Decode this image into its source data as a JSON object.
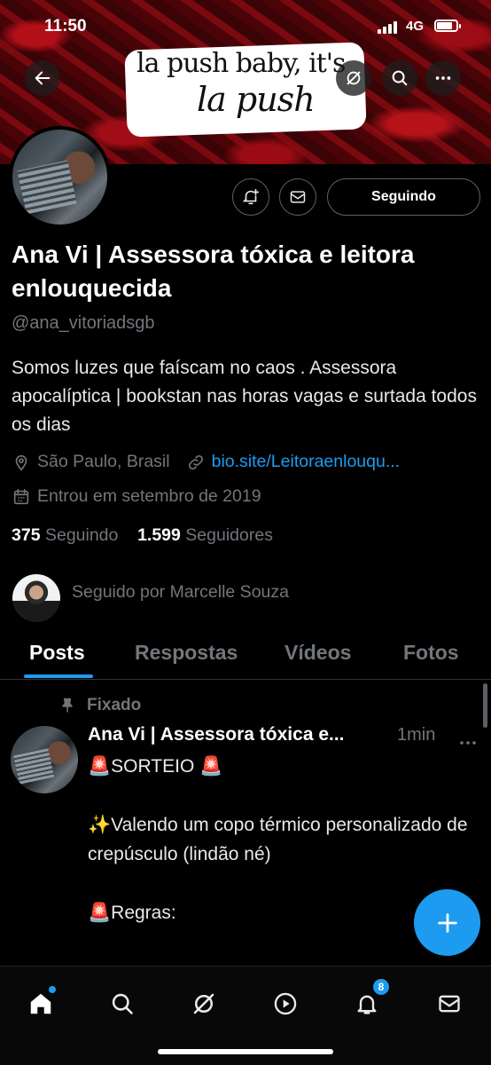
{
  "status": {
    "time": "11:50",
    "network": "4G",
    "battery_level": 0.8
  },
  "banner": {
    "line1": "la push baby, it's",
    "line2": "la push"
  },
  "profile": {
    "following_button": "Seguindo",
    "name": "Ana Vi | Assessora tóxica e leitora enlouquecida",
    "handle": "@ana_vitoriadsgb",
    "bio": "Somos luzes que faíscam no caos . Assessora apocalíptica | bookstan nas horas vagas e surtada todos os dias",
    "location": "São Paulo, Brasil",
    "website": "bio.site/Leitoraenlouqu...",
    "joined": "Entrou em setembro de 2019",
    "following_count": "375",
    "following_label": "Seguindo",
    "followers_count": "1.599",
    "followers_label": "Seguidores",
    "followed_by": "Seguido por Marcelle Souza"
  },
  "tabs": [
    "Posts",
    "Respostas",
    "Vídeos",
    "Fotos"
  ],
  "active_tab": "Posts",
  "post": {
    "pinned_label": "Fixado",
    "author": "Ana Vi | Assessora tóxica e...",
    "time": "1min",
    "text": "🚨SORTEIO 🚨\n\n✨Valendo um copo térmico personalizado de crepúsculo (lindão né)\n\n🚨Regras:"
  },
  "nav": {
    "notifications_badge": "8"
  },
  "colors": {
    "accent": "#1d9bf0",
    "muted": "#71767b",
    "background": "#000000"
  },
  "icons": [
    "back-arrow-icon",
    "grok-icon",
    "search-icon",
    "more-icon",
    "bell-plus-icon",
    "mail-icon",
    "location-icon",
    "link-icon",
    "calendar-icon",
    "pin-icon",
    "plus-icon",
    "home-icon",
    "explore-icon",
    "grok-icon",
    "video-icon",
    "notifications-icon",
    "messages-icon"
  ]
}
